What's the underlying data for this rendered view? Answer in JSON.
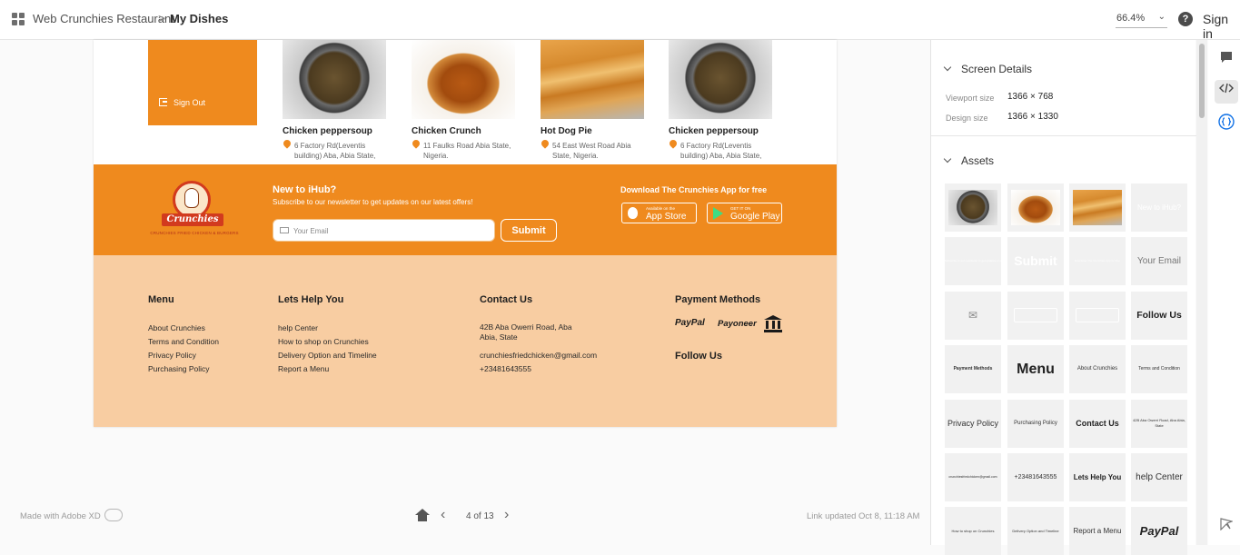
{
  "topbar": {
    "app_name": "Web Crunchies Restaurant",
    "separator": ">",
    "page_name": "My Dishes",
    "zoom": "66.4%",
    "help": "?",
    "signin": "Sign in"
  },
  "artboard": {
    "signout": "Sign Out",
    "dishes": [
      {
        "name": "Chicken peppersoup",
        "address": "6 Factory Rd(Leventis building) Aba, Abia State,",
        "image": "soup"
      },
      {
        "name": "Chicken Crunch",
        "address": "11 Faulks Road Abia State, Nigeria.",
        "image": "chicken"
      },
      {
        "name": "Hot Dog Pie",
        "address": "54 East West Road Abia State, Nigeria.",
        "image": "hotdog"
      },
      {
        "name": "Chicken peppersoup",
        "address": "6 Factory Rd(Leventis building) Aba, Abia State,",
        "image": "soup"
      }
    ],
    "newsletter": {
      "logo_text": "Crunchies",
      "logo_subtext": "CRUNCHIES FRIED CHICKEN & BURGERS",
      "title": "New to iHub?",
      "subtitle": "Subscribe to our newsletter to get updates on our latest offers!",
      "email_placeholder": "Your Email",
      "submit": "Submit",
      "download_title": "Download The Crunchies App for free",
      "appstore_small": "Available on the",
      "appstore_big": "App Store",
      "googleplay_small": "GET IT ON",
      "googleplay_big": "Google Play"
    },
    "footer": {
      "menu_title": "Menu",
      "menu_links": [
        "About Crunchies",
        "Terms and Condition",
        "Privacy Policy",
        "Purchasing Policy"
      ],
      "help_title": "Lets Help You",
      "help_links": [
        "help Center",
        "How to shop on Crunchies",
        "Delivery Option and Timeline",
        "Report a Menu"
      ],
      "contact_title": "Contact Us",
      "contact_address": "42B Aba Owerri Road, Aba Abia, State",
      "contact_email": "crunchiesfriedchicken@gmail.com",
      "contact_phone": "+23481643555",
      "payment_title": "Payment Methods",
      "paypal": "PayPal",
      "payoneer": "Payoneer",
      "follow_title": "Follow Us"
    }
  },
  "bottombar": {
    "made_with": "Made with Adobe XD",
    "page_count": "4 of 13",
    "link_updated": "Link updated Oct 8, 11:18 AM"
  },
  "panel": {
    "screen_details_title": "Screen Details",
    "viewport_label": "Viewport size",
    "viewport_value": "1366 × 768",
    "design_label": "Design size",
    "design_value": "1366 × 1330",
    "assets_title": "Assets",
    "asset_texts": {
      "new_to_ihub": "New to iHub?",
      "submit": "Submit",
      "your_email": "Your Email",
      "follow_us": "Follow Us",
      "payment_methods": "Payment Methods",
      "menu": "Menu",
      "about": "About Crunchies",
      "terms": "Terms and Condition",
      "privacy": "Privacy Policy",
      "purchasing": "Purchasing Policy",
      "contact": "Contact Us",
      "address": "42B Aba Owerri Road, Aba Abia, State",
      "email": "crunchiesfriedchicken@gmail.com",
      "phone": "+23481643555",
      "lets_help": "Lets Help You",
      "help_center": "help Center",
      "how_to_shop": "How to shop on Crunchies",
      "delivery": "Delivery Option and Timeline",
      "report": "Report a Menu",
      "paypal": "PayPal"
    }
  },
  "colors": {
    "brand_orange": "#ef8a1e",
    "footer_peach": "#f8cda2",
    "accent_blue": "#1473e6"
  }
}
